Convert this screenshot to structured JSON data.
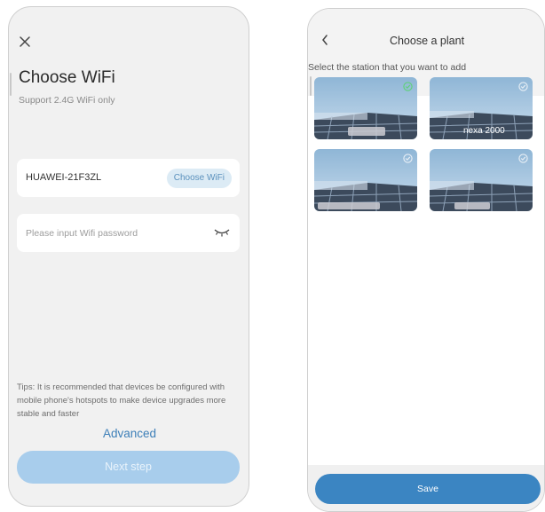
{
  "left_screen": {
    "close_icon": "close-icon",
    "title": "Choose WiFi",
    "subtitle": "Support 2.4G WiFi only",
    "wifi_name": "HUAWEI-21F3ZL",
    "choose_wifi_label": "Choose WiFi",
    "password_placeholder": "Please input Wifi password",
    "eye_icon": "eye-closed-icon",
    "tips": "Tips: It is recommended that devices be configured with mobile phone's hotspots to make device upgrades more stable and faster",
    "advanced_label": "Advanced",
    "next_label": "Next step",
    "colors": {
      "accent": "#3d7fb8",
      "next_button": "#a8cdec",
      "chip": "#dcebf5"
    }
  },
  "right_screen": {
    "back_icon": "back-chevron-icon",
    "title": "Choose a plant",
    "subtitle": "Select the station that you want to add",
    "plants": [
      {
        "name": "",
        "selected": true
      },
      {
        "name": "nexa 2000",
        "selected": false
      },
      {
        "name": "",
        "selected": false
      },
      {
        "name": "",
        "selected": false
      }
    ],
    "save_label": "Save",
    "colors": {
      "save_button": "#3b85c2",
      "selected_check": "#5fd17a"
    }
  }
}
